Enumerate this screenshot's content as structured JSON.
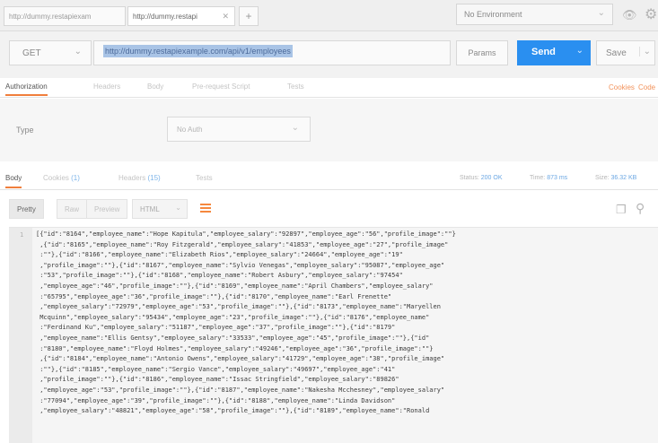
{
  "tabs": [
    {
      "label": "http://dummy.restapiexam"
    },
    {
      "label": "http://dummy.restapi"
    }
  ],
  "new_tab_symbol": "+",
  "environment": {
    "label": "No Environment"
  },
  "request": {
    "method": "GET",
    "url": "http://dummy.restapiexample.com/api/v1/employees",
    "params_label": "Params",
    "send_label": "Send",
    "save_label": "Save"
  },
  "request_tabs": [
    "Authorization",
    "Headers",
    "Body",
    "Pre-request Script",
    "Tests"
  ],
  "request_links": {
    "cookies": "Cookies",
    "code": "Code"
  },
  "auth": {
    "type_label": "Type",
    "type_value": "No Auth"
  },
  "response_tabs": {
    "body": "Body",
    "cookies": "Cookies",
    "cookies_count": "(1)",
    "headers": "Headers",
    "headers_count": "(15)",
    "tests": "Tests"
  },
  "response_meta": {
    "status_label": "Status:",
    "status_value": "200 OK",
    "time_label": "Time:",
    "time_value": "873 ms",
    "size_label": "Size:",
    "size_value": "36.32 KB"
  },
  "view_modes": [
    "Pretty",
    "Raw",
    "Preview"
  ],
  "format": "HTML",
  "code": {
    "line_number": "1",
    "lines": [
      "[{\"id\":\"8164\",\"employee_name\":\"Hope Kapitula\",\"employee_salary\":\"92897\",\"employee_age\":\"56\",\"profile_image\":\"\"}",
      " ,{\"id\":\"8165\",\"employee_name\":\"Roy Fitzgerald\",\"employee_salary\":\"41853\",\"employee_age\":\"27\",\"profile_image\"",
      " :\"\"},{\"id\":\"8166\",\"employee_name\":\"Elizabeth Rios\",\"employee_salary\":\"24664\",\"employee_age\":\"19\"",
      " ,\"profile_image\":\"\"},{\"id\":\"8167\",\"employee_name\":\"Sylvio Venegas\",\"employee_salary\":\"95087\",\"employee_age\"",
      " :\"53\",\"profile_image\":\"\"},{\"id\":\"8168\",\"employee_name\":\"Robert Asbury\",\"employee_salary\":\"97454\"",
      " ,\"employee_age\":\"46\",\"profile_image\":\"\"},{\"id\":\"8169\",\"employee_name\":\"April Chambers\",\"employee_salary\"",
      " :\"65795\",\"employee_age\":\"36\",\"profile_image\":\"\"},{\"id\":\"8170\",\"employee_name\":\"Earl Frenette\"",
      " ,\"employee_salary\":\"72979\",\"employee_age\":\"53\",\"profile_image\":\"\"},{\"id\":\"8173\",\"employee_name\":\"Maryellen",
      " Mcquinn\",\"employee_salary\":\"95434\",\"employee_age\":\"23\",\"profile_image\":\"\"},{\"id\":\"8176\",\"employee_name\"",
      " :\"Ferdinand Ku\",\"employee_salary\":\"51187\",\"employee_age\":\"37\",\"profile_image\":\"\"},{\"id\":\"8179\"",
      " ,\"employee_name\":\"Ellis Gentsy\",\"employee_salary\":\"33533\",\"employee_age\":\"45\",\"profile_image\":\"\"},{\"id\"",
      " :\"8180\",\"employee_name\":\"Floyd Holmes\",\"employee_salary\":\"49246\",\"employee_age\":\"36\",\"profile_image\":\"\"}",
      " ,{\"id\":\"8184\",\"employee_name\":\"Antonio Owens\",\"employee_salary\":\"41729\",\"employee_age\":\"38\",\"profile_image\"",
      " :\"\"},{\"id\":\"8185\",\"employee_name\":\"Sergio Vance\",\"employee_salary\":\"49697\",\"employee_age\":\"41\"",
      " ,\"profile_image\":\"\"},{\"id\":\"8186\",\"employee_name\":\"Issac Stringfield\",\"employee_salary\":\"89826\"",
      " ,\"employee_age\":\"53\",\"profile_image\":\"\"},{\"id\":\"8187\",\"employee_name\":\"Nakesha Mcchesney\",\"employee_salary\"",
      " :\"77094\",\"employee_age\":\"39\",\"profile_image\":\"\"},{\"id\":\"8188\",\"employee_name\":\"Linda Davidson\"",
      " ,\"employee_salary\":\"48821\",\"employee_age\":\"58\",\"profile_image\":\"\"},{\"id\":\"8189\",\"employee_name\":\"Ronald"
    ]
  },
  "colors": {
    "accent": "#f07e3c",
    "send_button": "#2a8ff0",
    "url_highlight": "#a9c4e6"
  },
  "icons": [
    "close-icon",
    "plus-icon",
    "chevron-down-icon",
    "eye-icon",
    "gear-icon",
    "wrap-lines-icon",
    "copy-icon",
    "search-icon"
  ]
}
